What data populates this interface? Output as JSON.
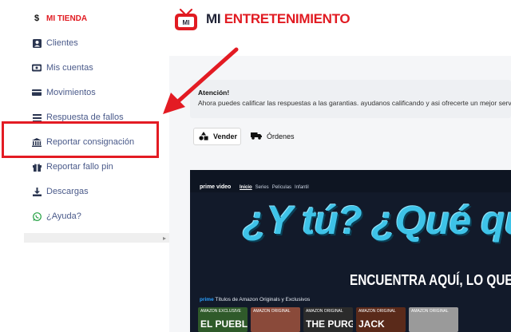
{
  "sidebar": {
    "brand": {
      "label": "MI TIENDA",
      "icon": "dollar-icon"
    },
    "items": [
      {
        "label": "Clientes",
        "icon": "user-icon"
      },
      {
        "label": "Mis cuentas",
        "icon": "card-icon"
      },
      {
        "label": "Movimientos",
        "icon": "money-icon"
      },
      {
        "label": "Respuesta de fallos",
        "icon": "list-icon"
      },
      {
        "label": "Reportar consignación",
        "icon": "bank-icon"
      },
      {
        "label": "Reportar fallo pin",
        "icon": "gift-icon"
      },
      {
        "label": "Descargas",
        "icon": "download-icon"
      },
      {
        "label": "¿Ayuda?",
        "icon": "whatsapp-icon"
      }
    ]
  },
  "header": {
    "title_part1": "MI ",
    "title_part2": "ENTRETENIMIENTO",
    "logo_text": "MI"
  },
  "alert": {
    "title": "Atención!",
    "text": "Ahora puedes calificar las respuestas a las garantias. ayudanos calificando y asi ofrecerte un mejor servicio"
  },
  "tabs": [
    {
      "label": "Vender",
      "icon": "shapes-icon",
      "active": true
    },
    {
      "label": "Órdenes",
      "icon": "truck-icon",
      "active": false
    }
  ],
  "banner": {
    "brand": "prime video",
    "nav": [
      "Inicio",
      "Series",
      "Películas",
      "Infantil"
    ],
    "headline": "¿Y tú? ¿Qué quieres",
    "tagline": "ENCUENTRA AQUÍ, LO QUE",
    "prime_label": "prime",
    "row_title": "Títulos de Amazon Originals y Exclusivos",
    "posters": [
      {
        "tag": "AMAZON EXCLUSIVE",
        "name": "EL PUEBLO",
        "color": "#2f5a2a"
      },
      {
        "tag": "AMAZON ORIGINAL",
        "name": "",
        "color": "#8a4a3a"
      },
      {
        "tag": "AMAZON ORIGINAL",
        "name": "THE PURGE",
        "color": "#2b2b2b"
      },
      {
        "tag": "AMAZON ORIGINAL",
        "name": "JACK",
        "color": "#5a2a1a"
      },
      {
        "tag": "AMAZON ORIGINAL",
        "name": "",
        "color": "#9a9a9a"
      }
    ]
  },
  "colors": {
    "accent": "#e11b22",
    "sidebar_text": "#4a5a8a",
    "highlight": "#e31b23"
  }
}
